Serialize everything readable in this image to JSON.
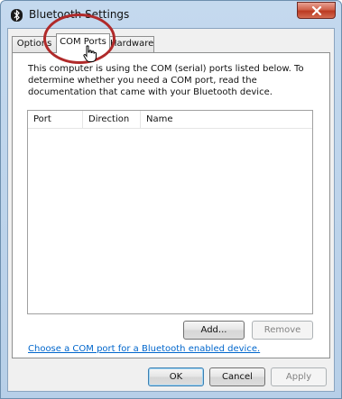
{
  "window": {
    "title": "Bluetooth Settings",
    "app_icon": "bluetooth-icon",
    "close_icon": "close-icon"
  },
  "tabs": [
    {
      "label": "Options",
      "active": false
    },
    {
      "label": "COM Ports",
      "active": true
    },
    {
      "label": "Hardware",
      "active": false
    }
  ],
  "com_ports": {
    "description": "This computer is using the COM (serial) ports listed below. To determine whether you need a COM port, read the documentation that came with your Bluetooth device.",
    "columns": [
      "Port",
      "Direction",
      "Name"
    ],
    "rows": [],
    "add_label": "Add...",
    "remove_label": "Remove",
    "help_link": "Choose a COM port for a Bluetooth enabled device."
  },
  "footer": {
    "ok_label": "OK",
    "cancel_label": "Cancel",
    "apply_label": "Apply"
  },
  "colors": {
    "highlight": "#b02a2a",
    "link": "#0066cc"
  }
}
